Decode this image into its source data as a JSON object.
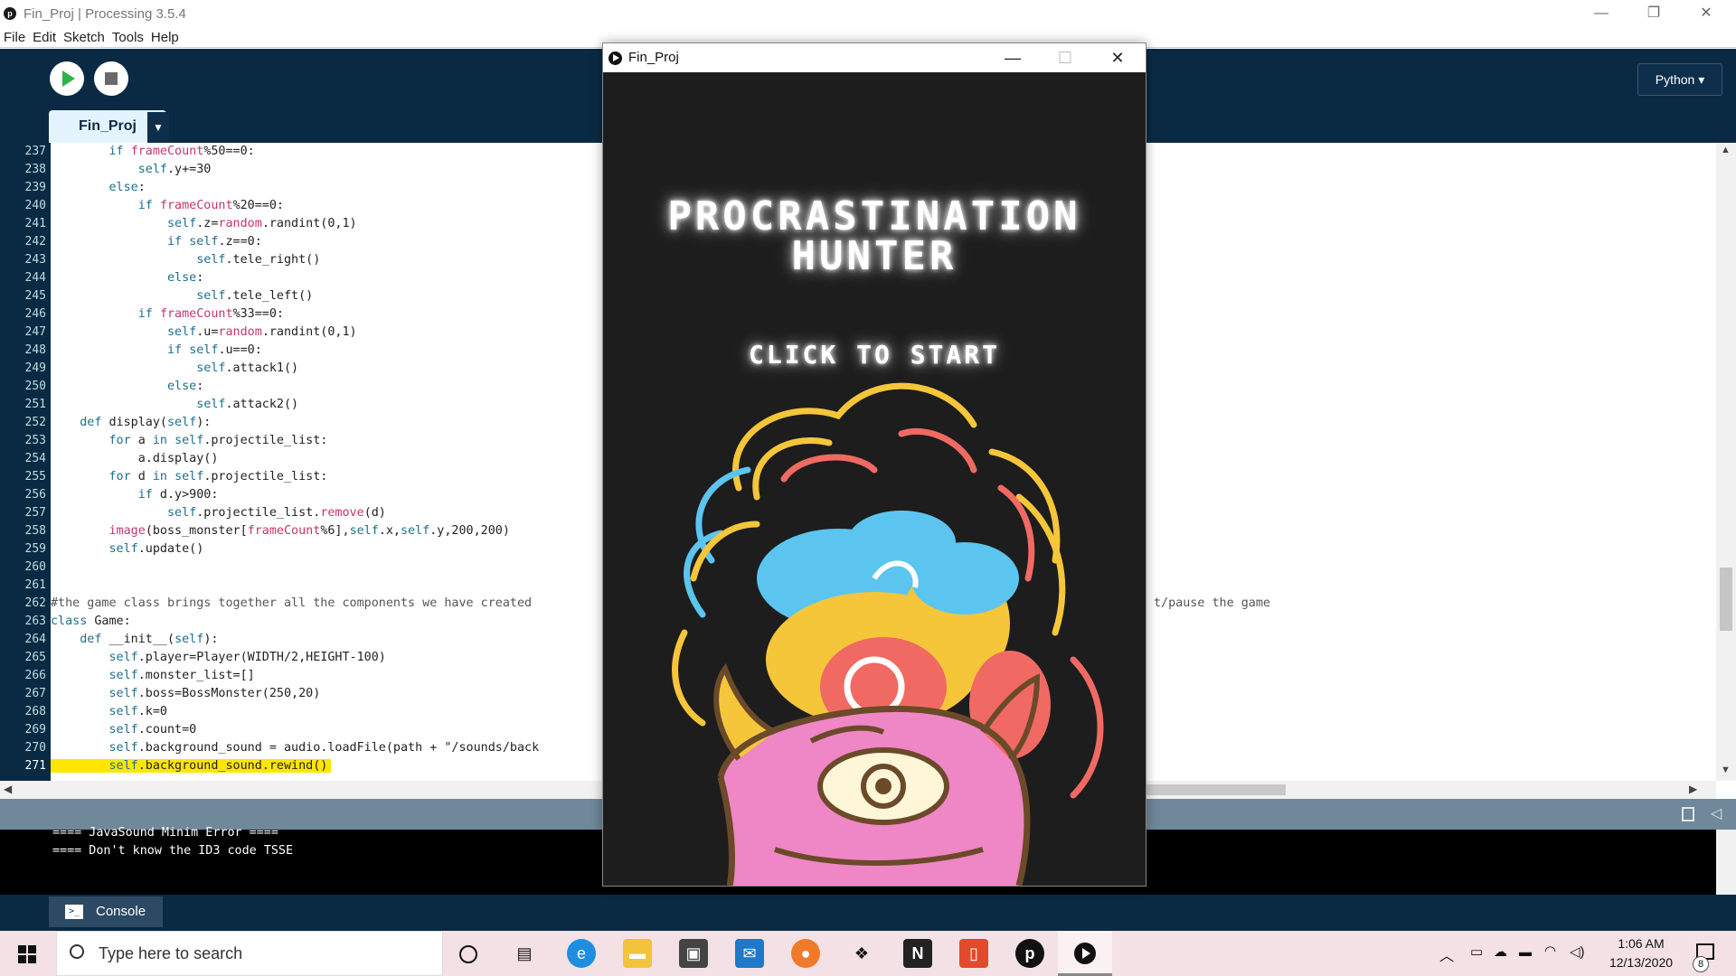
{
  "window": {
    "title": "Fin_Proj | Processing 3.5.4",
    "minimize": "—",
    "restore": "❐",
    "close": "✕"
  },
  "menu": [
    "File",
    "Edit",
    "Sketch",
    "Tools",
    "Help"
  ],
  "toolbar": {
    "run_icon": "play-icon",
    "stop_icon": "stop-icon",
    "mode_label": "Python ▾"
  },
  "tab": {
    "label": "Fin_Proj",
    "dropdown": "▼"
  },
  "code_lines": [
    {
      "n": "237",
      "t": "        if frameCount%50==0:"
    },
    {
      "n": "238",
      "t": "            self.y+=30"
    },
    {
      "n": "239",
      "t": "        else:"
    },
    {
      "n": "240",
      "t": "            if frameCount%20==0:"
    },
    {
      "n": "241",
      "t": "                self.z=random.randint(0,1)"
    },
    {
      "n": "242",
      "t": "                if self.z==0:"
    },
    {
      "n": "243",
      "t": "                    self.tele_right()"
    },
    {
      "n": "244",
      "t": "                else:"
    },
    {
      "n": "245",
      "t": "                    self.tele_left()"
    },
    {
      "n": "246",
      "t": "            if frameCount%33==0:"
    },
    {
      "n": "247",
      "t": "                self.u=random.randint(0,1)"
    },
    {
      "n": "248",
      "t": "                if self.u==0:"
    },
    {
      "n": "249",
      "t": "                    self.attack1()"
    },
    {
      "n": "250",
      "t": "                else:"
    },
    {
      "n": "251",
      "t": "                    self.attack2()"
    },
    {
      "n": "252",
      "t": "    def display(self):"
    },
    {
      "n": "253",
      "t": "        for a in self.projectile_list:"
    },
    {
      "n": "254",
      "t": "            a.display()"
    },
    {
      "n": "255",
      "t": "        for d in self.projectile_list:"
    },
    {
      "n": "256",
      "t": "            if d.y>900:"
    },
    {
      "n": "257",
      "t": "                self.projectile_list.remove(d)"
    },
    {
      "n": "258",
      "t": "        image(boss_monster[frameCount%6],self.x,self.y,200,200)"
    },
    {
      "n": "259",
      "t": "        self.update()"
    },
    {
      "n": "260",
      "t": ""
    },
    {
      "n": "261",
      "t": ""
    },
    {
      "n": "262",
      "t": "#the game class brings together all the components we have created "
    },
    {
      "n": "263",
      "t": "class Game:"
    },
    {
      "n": "264",
      "t": "    def __init__(self):"
    },
    {
      "n": "265",
      "t": "        self.player=Player(WIDTH/2,HEIGHT-100)"
    },
    {
      "n": "266",
      "t": "        self.monster_list=[]"
    },
    {
      "n": "267",
      "t": "        self.boss=BossMonster(250,20)"
    },
    {
      "n": "268",
      "t": "        self.k=0"
    },
    {
      "n": "269",
      "t": "        self.count=0"
    },
    {
      "n": "270",
      "t": "        self.background_sound = audio.loadFile(path + \"/sounds/back"
    },
    {
      "n": "271",
      "t": "        self.background_sound.rewind()"
    }
  ],
  "code_tail_262": "t/pause the game",
  "console": {
    "lines": [
      "==== JavaSound Minim Error ====",
      "==== Don't know the ID3 code TSSE"
    ],
    "tab_label": "Console"
  },
  "sketch": {
    "title": "Fin_Proj",
    "game_title_1": "PROCRASTINATION",
    "game_title_2": "HUNTER",
    "start_prompt": "CLICK TO START"
  },
  "taskbar": {
    "search_placeholder": "Type here to search",
    "time": "1:06 AM",
    "date": "12/13/2020",
    "notification_count": "8"
  },
  "colors": {
    "ide_dark": "#0a2a44",
    "highlight": "#ffe600",
    "keyword": "#1e6e8e",
    "function": "#c3366b"
  }
}
